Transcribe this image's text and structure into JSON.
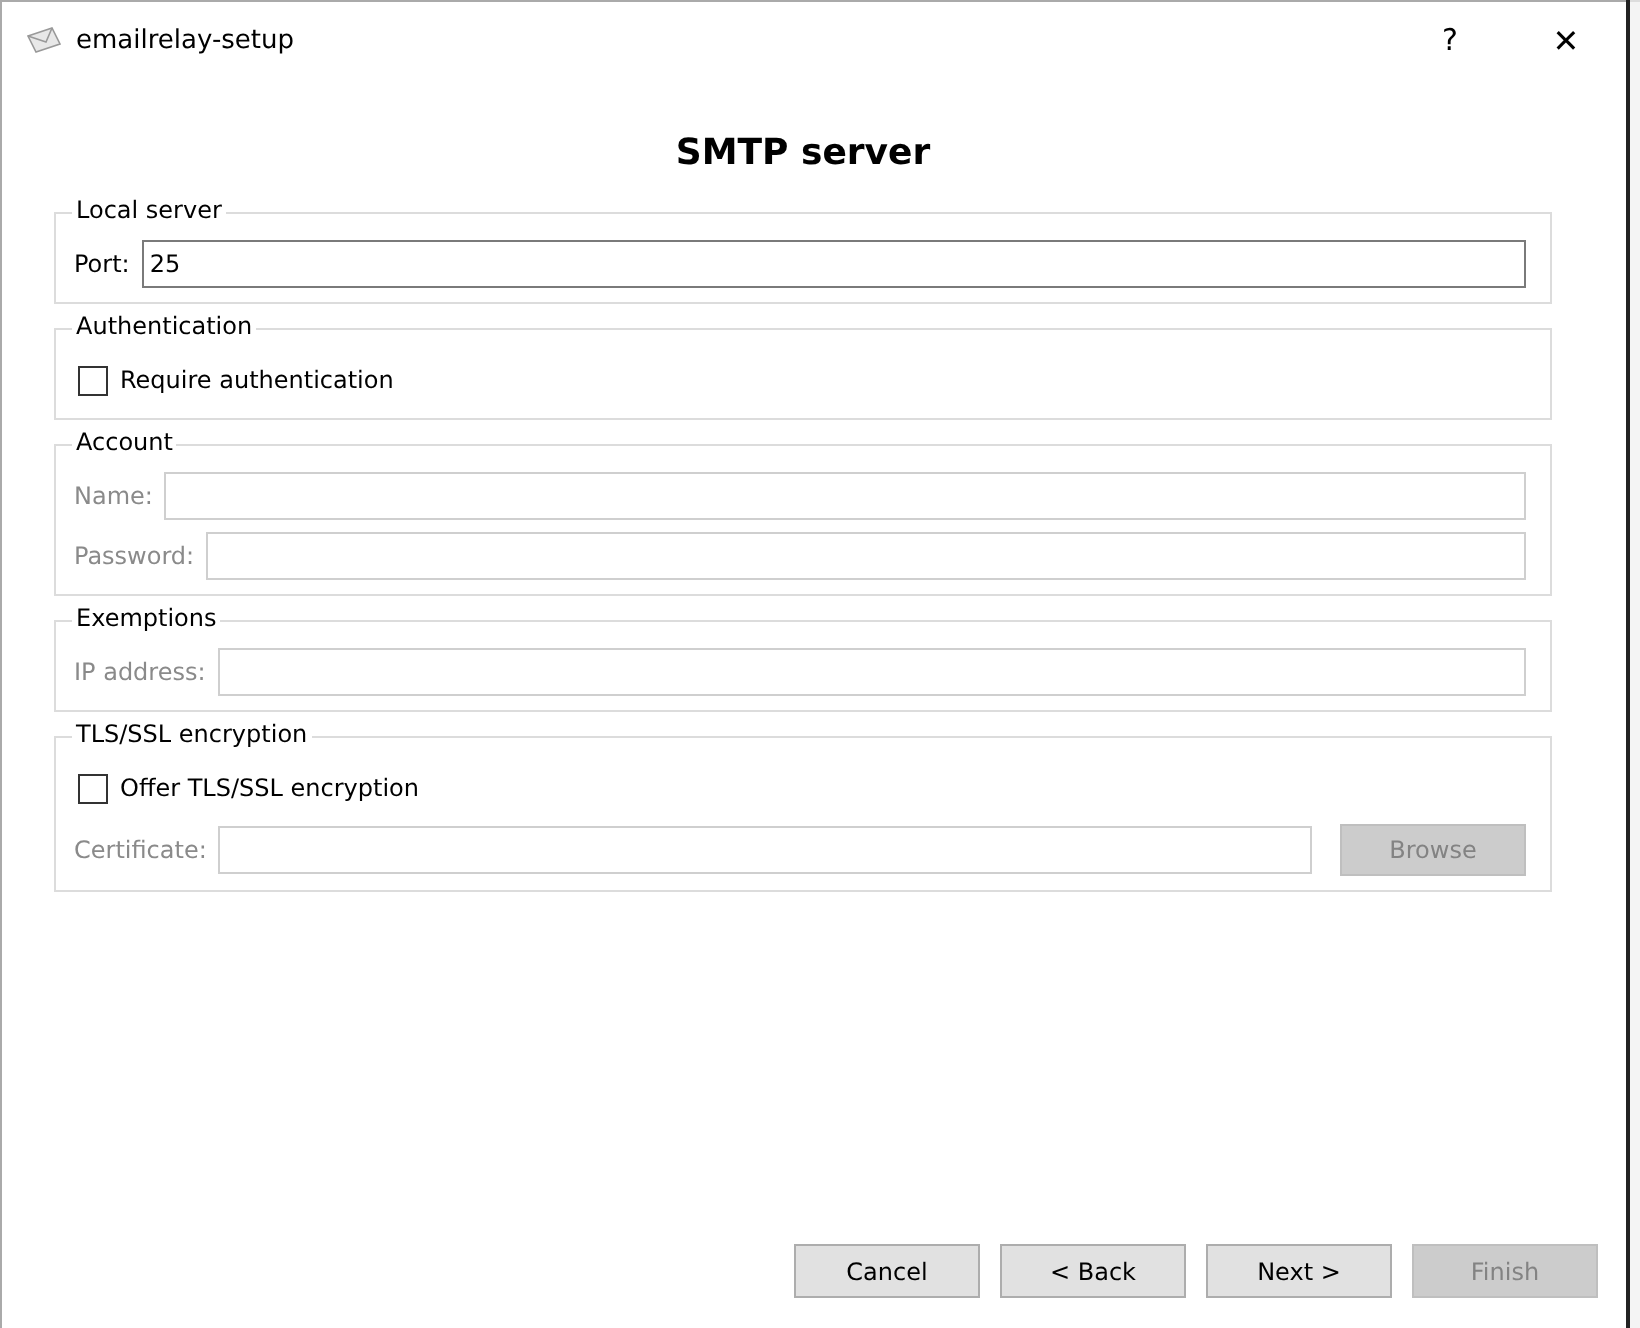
{
  "window": {
    "title": "emailrelay-setup",
    "help": "?",
    "close": "✕"
  },
  "heading": "SMTP server",
  "groups": [
    {
      "title": "Local server",
      "rows": [
        {
          "kind": "field",
          "label": "Port:",
          "value": "25",
          "disabled": false
        }
      ]
    },
    {
      "title": "Authentication",
      "rows": [
        {
          "kind": "checkbox",
          "label": "Require authentication",
          "checked": false
        }
      ]
    },
    {
      "title": "Account",
      "rows": [
        {
          "kind": "field",
          "label": "Name:",
          "value": "",
          "disabled": true
        },
        {
          "kind": "field",
          "label": "Password:",
          "value": "",
          "disabled": true
        }
      ]
    },
    {
      "title": "Exemptions",
      "rows": [
        {
          "kind": "field",
          "label": "IP address:",
          "value": "",
          "disabled": true
        }
      ]
    },
    {
      "title": "TLS/SSL encryption",
      "rows": [
        {
          "kind": "checkbox",
          "label": "Offer TLS/SSL encryption",
          "checked": false
        },
        {
          "kind": "file",
          "label": "Certificate:",
          "value": "",
          "disabled": true,
          "button": "Browse"
        }
      ]
    }
  ],
  "buttons": [
    {
      "label": "Cancel",
      "disabled": false
    },
    {
      "label": "< Back",
      "disabled": false
    },
    {
      "label": "Next >",
      "disabled": false
    },
    {
      "label": "Finish",
      "disabled": true
    }
  ]
}
